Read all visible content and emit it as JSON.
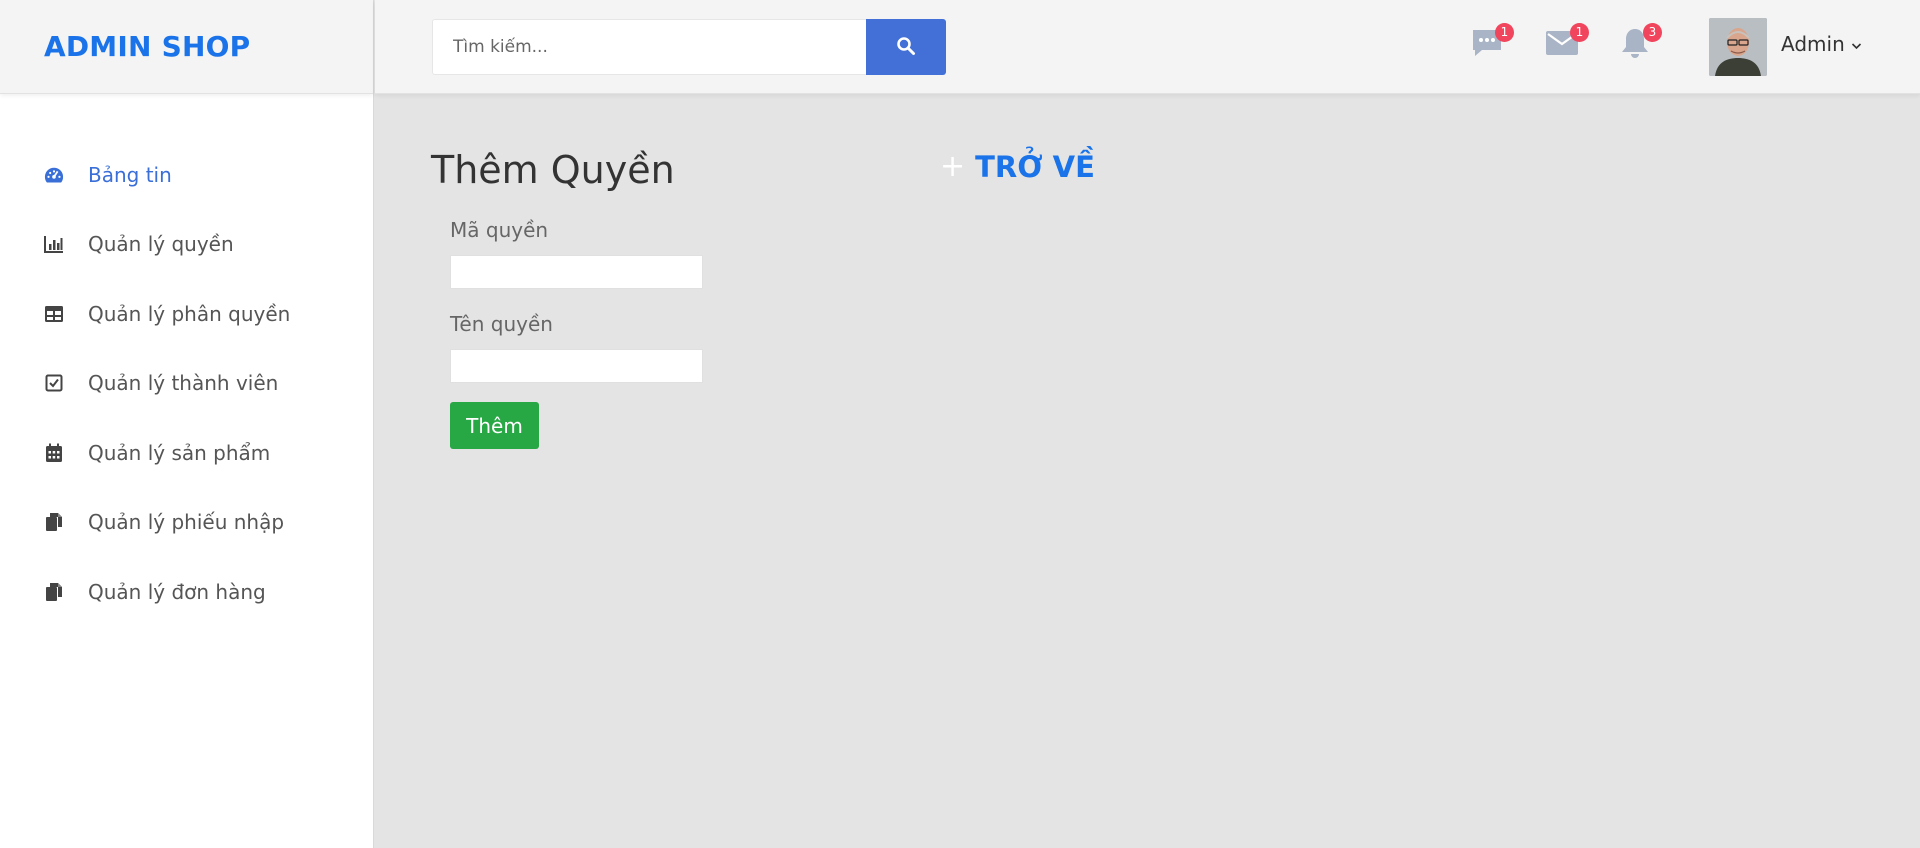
{
  "brand": {
    "title": "ADMIN SHOP"
  },
  "sidebar": {
    "items": [
      {
        "label": "Bảng tin",
        "icon": "dashboard-icon",
        "active": true
      },
      {
        "label": "Quản lý quyền",
        "icon": "bar-chart-icon"
      },
      {
        "label": "Quản lý phân quyền",
        "icon": "table-icon"
      },
      {
        "label": "Quản lý thành viên",
        "icon": "check-square-icon"
      },
      {
        "label": "Quản lý sản phẩm",
        "icon": "calendar-icon"
      },
      {
        "label": "Quản lý phiếu nhập",
        "icon": "copy-icon"
      },
      {
        "label": "Quản lý đơn hàng",
        "icon": "copy-icon"
      }
    ]
  },
  "header": {
    "search": {
      "placeholder": "Tìm kiếm...",
      "icon": "search-icon"
    },
    "notifications": [
      {
        "icon": "chat-icon",
        "count": "1"
      },
      {
        "icon": "mail-icon",
        "count": "1"
      },
      {
        "icon": "bell-icon",
        "count": "3"
      }
    ],
    "user": {
      "name": "Admin",
      "avatar": "avatar"
    }
  },
  "main": {
    "title": "Thêm Quyền",
    "back_link": {
      "plus": "+",
      "label": "TRỞ VỀ"
    },
    "form": {
      "code_label": "Mã quyền",
      "code_value": "",
      "name_label": "Tên quyền",
      "name_value": "",
      "submit_label": "Thêm"
    }
  },
  "colors": {
    "brand": "#1a73e8",
    "search_button": "#4270d6",
    "badge": "#f0455c",
    "submit": "#28a745",
    "active_nav": "#3a6fd8"
  }
}
